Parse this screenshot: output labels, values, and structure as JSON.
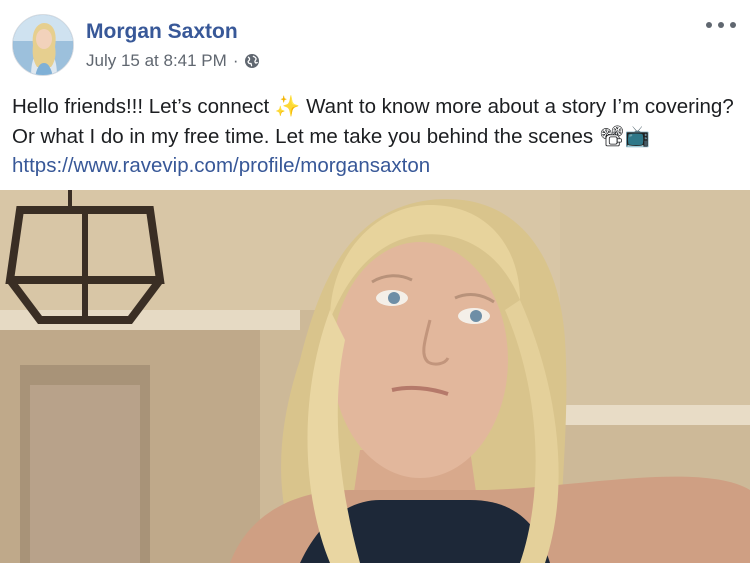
{
  "post": {
    "author": "Morgan Saxton",
    "timestamp": "July 15 at 8:41 PM",
    "separator": "·",
    "privacy_icon": "globe-icon",
    "more_icon": "more-options-icon",
    "text_part1": "Hello friends!!! Let’s connect ",
    "emoji_sparkles": "✨",
    "text_part2": " Want to know more about a story I’m covering? Or what I do in my free time. Let me take you behind the scenes ",
    "emoji_camera": "📽",
    "emoji_tv": "📺",
    "link": "https://www.ravevip.com/profile/morgansaxton"
  },
  "colors": {
    "link": "#385898",
    "meta": "#606770",
    "text": "#1c1e21"
  }
}
